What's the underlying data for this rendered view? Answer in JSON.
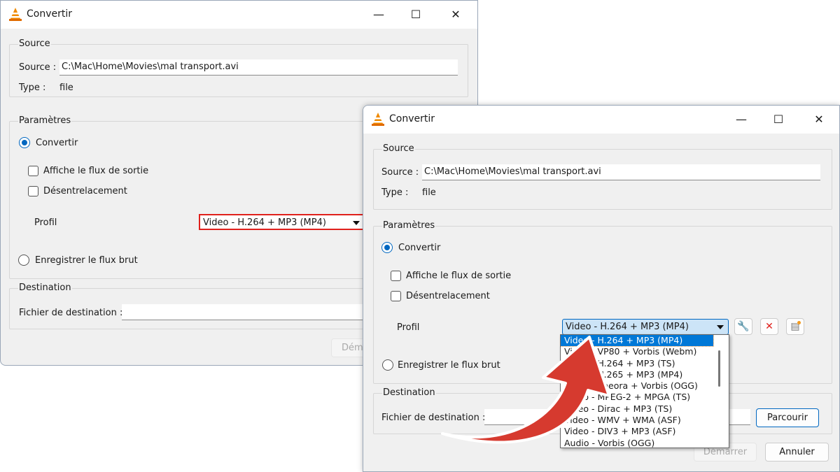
{
  "windows": [
    {
      "title": "Convertir",
      "source": {
        "group": "Source",
        "label": "Source :",
        "value": "C:\\Mac\\Home\\Movies\\mal transport.avi",
        "type_label": "Type :",
        "type_value": "file"
      },
      "params": {
        "group": "Paramètres",
        "convert": "Convertir",
        "show_output": "Affiche le flux de sortie",
        "deinterlace": "Désentrelacement",
        "profile_label": "Profil",
        "profile_value": "Video - H.264 + MP3 (MP4)",
        "raw": "Enregistrer le flux brut"
      },
      "dest": {
        "group": "Destination",
        "label": "Fichier de destination :",
        "value": ""
      },
      "start": "Démarrer"
    },
    {
      "title": "Convertir",
      "source": {
        "group": "Source",
        "label": "Source :",
        "value": "C:\\Mac\\Home\\Movies\\mal transport.avi",
        "type_label": "Type :",
        "type_value": "file"
      },
      "params": {
        "group": "Paramètres",
        "convert": "Convertir",
        "show_output": "Affiche le flux de sortie",
        "deinterlace": "Désentrelacement",
        "profile_label": "Profil",
        "profile_value": "Video - H.264 + MP3 (MP4)",
        "raw": "Enregistrer le flux brut"
      },
      "dest": {
        "group": "Destination",
        "label": "Fichier de destination :",
        "value": "",
        "browse": "Parcourir"
      },
      "start": "Démarrer",
      "cancel": "Annuler"
    }
  ],
  "profile_options": [
    "Video - H.264 + MP3 (MP4)",
    "Video - VP80 + Vorbis (Webm)",
    "Video - H.264 + MP3 (TS)",
    "Video - H.265 + MP3 (MP4)",
    "Video - Theora + Vorbis (OGG)",
    "Video - MPEG-2 + MPGA (TS)",
    "Video - Dirac + MP3 (TS)",
    "Video - WMV + WMA (ASF)",
    "Video - DIV3 + MP3 (ASF)",
    "Audio - Vorbis (OGG)"
  ],
  "icons": {
    "profile_tools": [
      "wrench-icon",
      "delete-icon",
      "new-profile-icon"
    ]
  },
  "colors": {
    "highlight": "#e0201c",
    "arrow": "#d63a2f",
    "selection": "#0078d7",
    "accent": "#0067c0"
  }
}
